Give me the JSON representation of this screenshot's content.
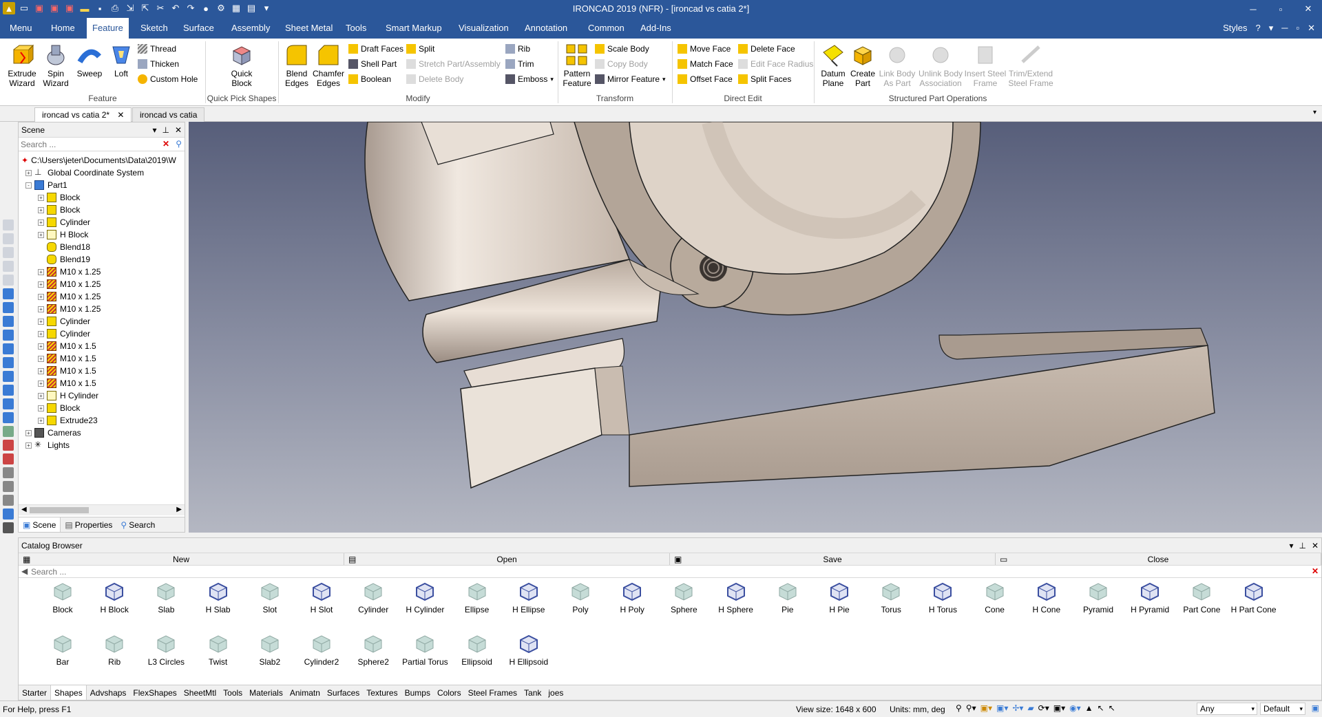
{
  "window": {
    "title": "IRONCAD 2019 (NFR) - [ironcad vs catia 2*]"
  },
  "menu": {
    "items": [
      "Menu",
      "Home",
      "Feature",
      "Sketch",
      "Surface",
      "Assembly",
      "Sheet Metal",
      "Tools",
      "Smart Markup",
      "Visualization",
      "Annotation",
      "Common",
      "Add-Ins"
    ],
    "active": "Feature",
    "styles_label": "Styles"
  },
  "ribbon": {
    "feature": {
      "extrude": "Extrude\nWizard",
      "spin": "Spin\nWizard",
      "sweep": "Sweep",
      "loft": "Loft",
      "thread": "Thread",
      "thicken": "Thicken",
      "custom_hole": "Custom Hole",
      "group": "Feature"
    },
    "quick_pick": {
      "quick_block": "Quick\nBlock",
      "group": "Quick Pick Shapes"
    },
    "modify": {
      "blend": "Blend\nEdges",
      "chamfer": "Chamfer\nEdges",
      "draft_faces": "Draft Faces",
      "shell_part": "Shell Part",
      "boolean": "Boolean",
      "split": "Split",
      "stretch": "Stretch Part/Assembly",
      "delete_body": "Delete Body",
      "rib": "Rib",
      "trim": "Trim",
      "emboss": "Emboss",
      "group": "Modify"
    },
    "transform": {
      "pattern": "Pattern\nFeature",
      "scale_body": "Scale Body",
      "copy_body": "Copy Body",
      "mirror": "Mirror Feature",
      "group": "Transform"
    },
    "direct_edit": {
      "move_face": "Move Face",
      "match_face": "Match Face",
      "offset_face": "Offset Face",
      "delete_face": "Delete Face",
      "edit_face_radius": "Edit Face Radius",
      "split_faces": "Split Faces",
      "group": "Direct Edit"
    },
    "structured": {
      "datum": "Datum\nPlane",
      "create_part": "Create\nPart",
      "link_body": "Link Body\nAs Part",
      "unlink_body": "Unlink Body\nAssociation",
      "insert_steel": "Insert Steel\nFrame",
      "trim_steel": "Trim/Extend\nSteel Frame",
      "group": "Structured Part Operations"
    }
  },
  "doc_tabs": [
    "ironcad vs catia 2*",
    "ironcad vs catia"
  ],
  "scene": {
    "title": "Scene",
    "search_placeholder": "Search ...",
    "path": "C:\\Users\\jeter\\Documents\\Data\\2019\\W",
    "tree": [
      {
        "label": "Global Coordinate System",
        "level": 1,
        "exp": "+",
        "icon": "axis"
      },
      {
        "label": "Part1",
        "level": 1,
        "exp": "-",
        "icon": "part"
      },
      {
        "label": "Block",
        "level": 2,
        "exp": "+",
        "icon": "yellow"
      },
      {
        "label": "Block",
        "level": 2,
        "exp": "+",
        "icon": "yellow"
      },
      {
        "label": "Cylinder",
        "level": 2,
        "exp": "+",
        "icon": "yellow"
      },
      {
        "label": "H Block",
        "level": 2,
        "exp": "+",
        "icon": "hollow"
      },
      {
        "label": "Blend18",
        "level": 2,
        "exp": "",
        "icon": "blend"
      },
      {
        "label": "Blend19",
        "level": 2,
        "exp": "",
        "icon": "blend"
      },
      {
        "label": "M10 x 1.25",
        "level": 2,
        "exp": "+",
        "icon": "thread"
      },
      {
        "label": "M10 x 1.25",
        "level": 2,
        "exp": "+",
        "icon": "thread"
      },
      {
        "label": "M10 x 1.25",
        "level": 2,
        "exp": "+",
        "icon": "thread"
      },
      {
        "label": "M10 x 1.25",
        "level": 2,
        "exp": "+",
        "icon": "thread"
      },
      {
        "label": "Cylinder",
        "level": 2,
        "exp": "+",
        "icon": "yellow"
      },
      {
        "label": "Cylinder",
        "level": 2,
        "exp": "+",
        "icon": "yellow"
      },
      {
        "label": "M10 x 1.5",
        "level": 2,
        "exp": "+",
        "icon": "thread"
      },
      {
        "label": "M10 x 1.5",
        "level": 2,
        "exp": "+",
        "icon": "thread"
      },
      {
        "label": "M10 x 1.5",
        "level": 2,
        "exp": "+",
        "icon": "thread"
      },
      {
        "label": "M10 x 1.5",
        "level": 2,
        "exp": "+",
        "icon": "thread"
      },
      {
        "label": "H Cylinder",
        "level": 2,
        "exp": "+",
        "icon": "hollow"
      },
      {
        "label": "Block",
        "level": 2,
        "exp": "+",
        "icon": "yellow"
      },
      {
        "label": "Extrude23",
        "level": 2,
        "exp": "+",
        "icon": "yellow"
      },
      {
        "label": "Cameras",
        "level": 1,
        "exp": "+",
        "icon": "camera"
      },
      {
        "label": "Lights",
        "level": 1,
        "exp": "+",
        "icon": "light"
      }
    ],
    "tabs": [
      "Scene",
      "Properties",
      "Search"
    ]
  },
  "catalog": {
    "title": "Catalog Browser",
    "buttons": [
      "New",
      "Open",
      "Save",
      "Close"
    ],
    "search_placeholder": "Search ...",
    "shapes_row1": [
      "Block",
      "H Block",
      "Slab",
      "H Slab",
      "Slot",
      "H Slot",
      "Cylinder",
      "H Cylinder",
      "Ellipse",
      "H Ellipse",
      "Poly",
      "H Poly",
      "Sphere",
      "H Sphere",
      "Pie",
      "H Pie",
      "Torus",
      "H Torus",
      "Cone",
      "H Cone",
      "Pyramid",
      "H Pyramid",
      "Part Cone",
      "H Part Cone"
    ],
    "shapes_row2": [
      "Bar",
      "Rib",
      "L3 Circles",
      "Twist",
      "Slab2",
      "Cylinder2",
      "Sphere2",
      "Partial Torus",
      "Ellipsoid",
      "H Ellipsoid"
    ],
    "tabs": [
      "Starter",
      "Shapes",
      "Advshaps",
      "FlexShapes",
      "SheetMtl",
      "Tools",
      "Materials",
      "Animatn",
      "Surfaces",
      "Textures",
      "Bumps",
      "Colors",
      "Steel Frames",
      "Tank",
      "joes"
    ],
    "active_tab": "Shapes"
  },
  "status": {
    "help": "For Help, press F1",
    "view_size": "View size: 1648 x 600",
    "units": "Units: mm, deg",
    "filter": "Any",
    "style": "Default"
  },
  "colors": {
    "accent": "#2b579a",
    "part": "#d8cdc3",
    "viewport_top": "#575e7a"
  }
}
